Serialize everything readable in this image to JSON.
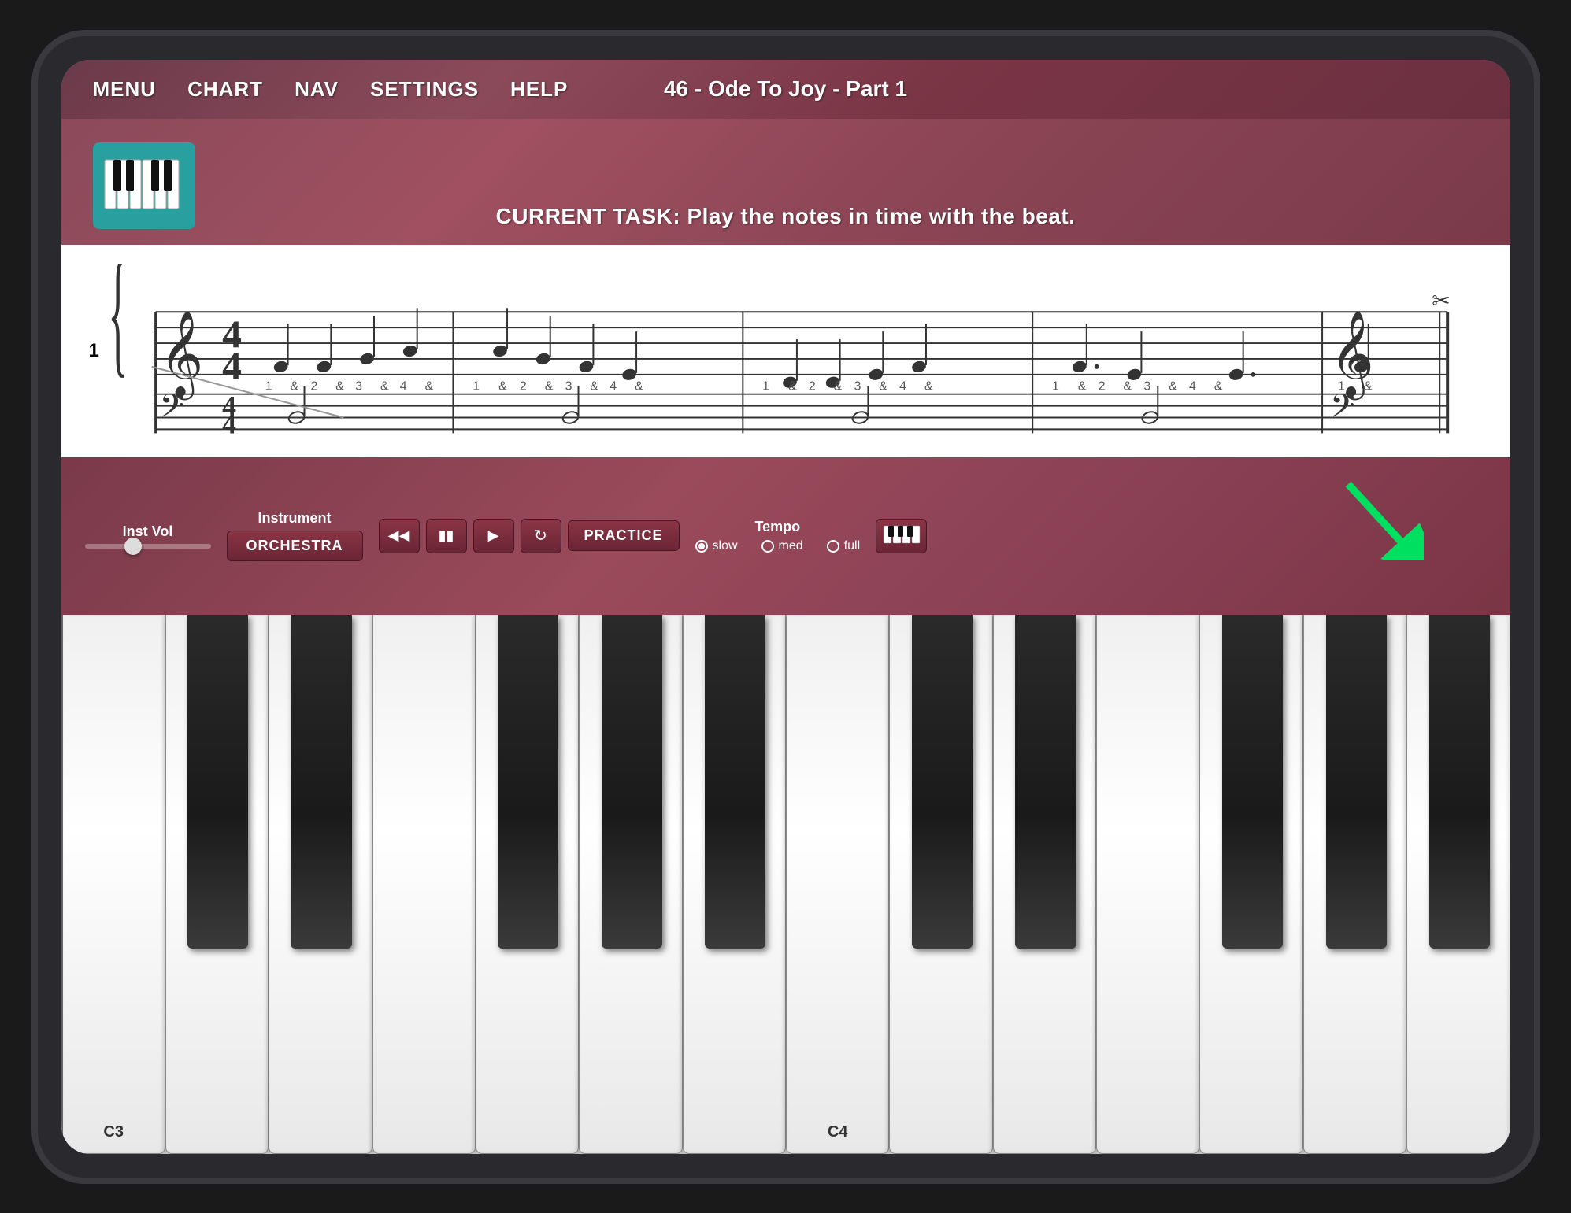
{
  "menu": {
    "items": [
      "MENU",
      "CHART",
      "NAV",
      "SETTINGS",
      "HELP"
    ]
  },
  "title": "46 - Ode To Joy - Part 1",
  "current_task": "CURRENT TASK: Play the notes in time with the beat.",
  "controls": {
    "vol_label": "Inst Vol",
    "instrument_label": "Instrument",
    "instrument_name": "ORCHESTRA",
    "practice_label": "PRACTICE",
    "tempo_label": "Tempo",
    "tempo_options": [
      "slow",
      "med",
      "full"
    ],
    "tempo_selected": "slow"
  },
  "piano": {
    "c3_label": "C3",
    "c4_label": "C4"
  },
  "measure_number": "1"
}
